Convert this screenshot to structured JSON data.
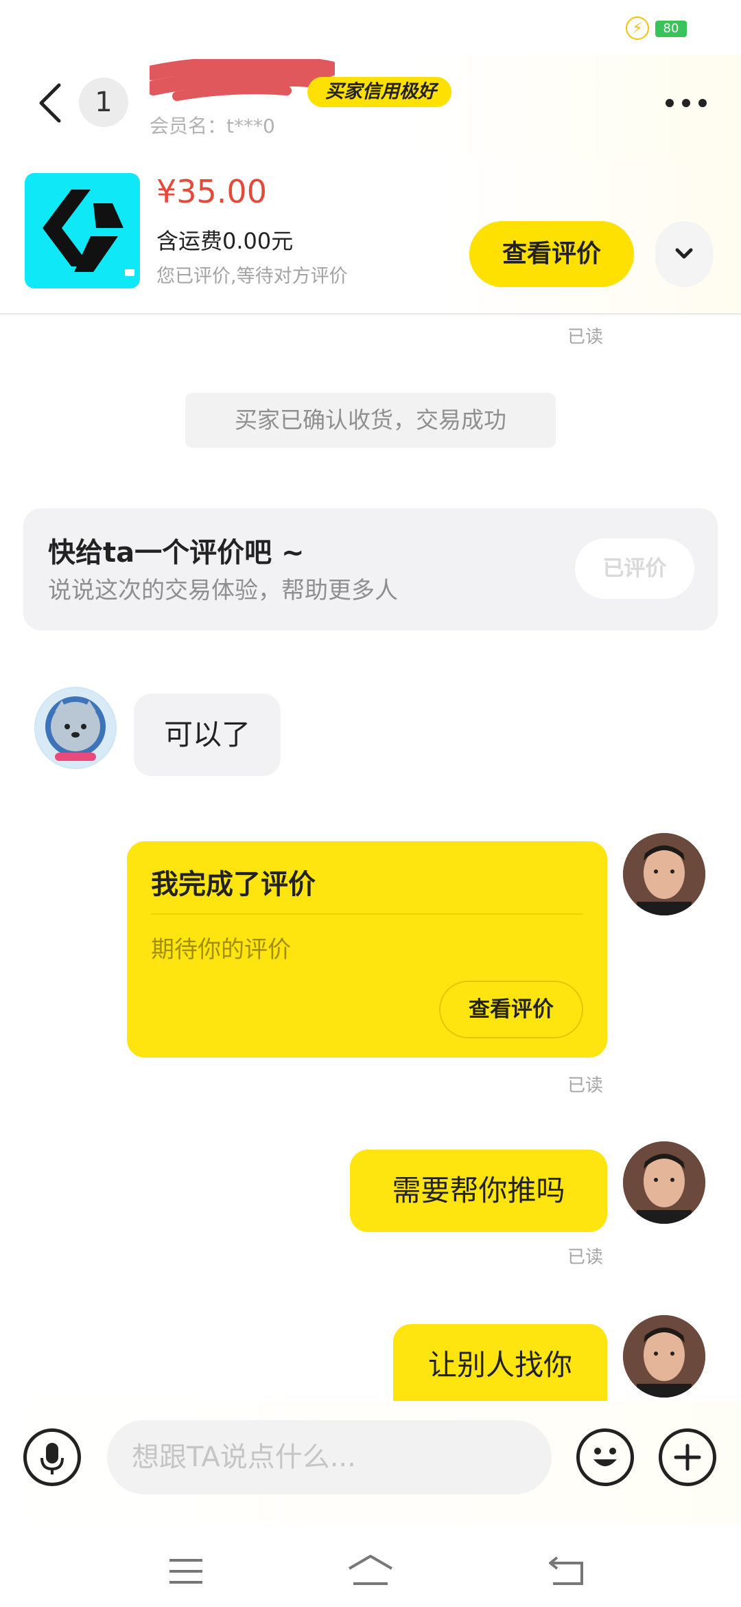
{
  "status_bar": {
    "battery": "80"
  },
  "header": {
    "unread_count": "1",
    "credit_tag": "买家信用极好",
    "member_name": "会员名：t***0"
  },
  "product": {
    "price": "¥35.00",
    "shipping": "含运费0.00元",
    "eval_status": "您已评价,等待对方评价",
    "view_eval_button": "查看评价",
    "thumb_color": "#0ee8f7"
  },
  "chat": {
    "read_label": "已读",
    "system_message": "买家已确认收货，交易成功",
    "rating_prompt": {
      "title": "快给ta一个评价吧 ~",
      "subtitle": "说说这次的交易体验，帮助更多人",
      "button": "已评价"
    },
    "messages": [
      {
        "side": "left",
        "text": "可以了"
      },
      {
        "side": "right",
        "type": "card",
        "title": "我完成了评价",
        "subtitle": "期待你的评价",
        "button": "查看评价"
      },
      {
        "side": "right",
        "text": "需要帮你推吗"
      },
      {
        "side": "right",
        "text": "让别人找你"
      }
    ]
  },
  "input_bar": {
    "placeholder": "想跟TA说点什么..."
  },
  "colors": {
    "accent": "#ffe100",
    "price": "#e34a3a"
  }
}
